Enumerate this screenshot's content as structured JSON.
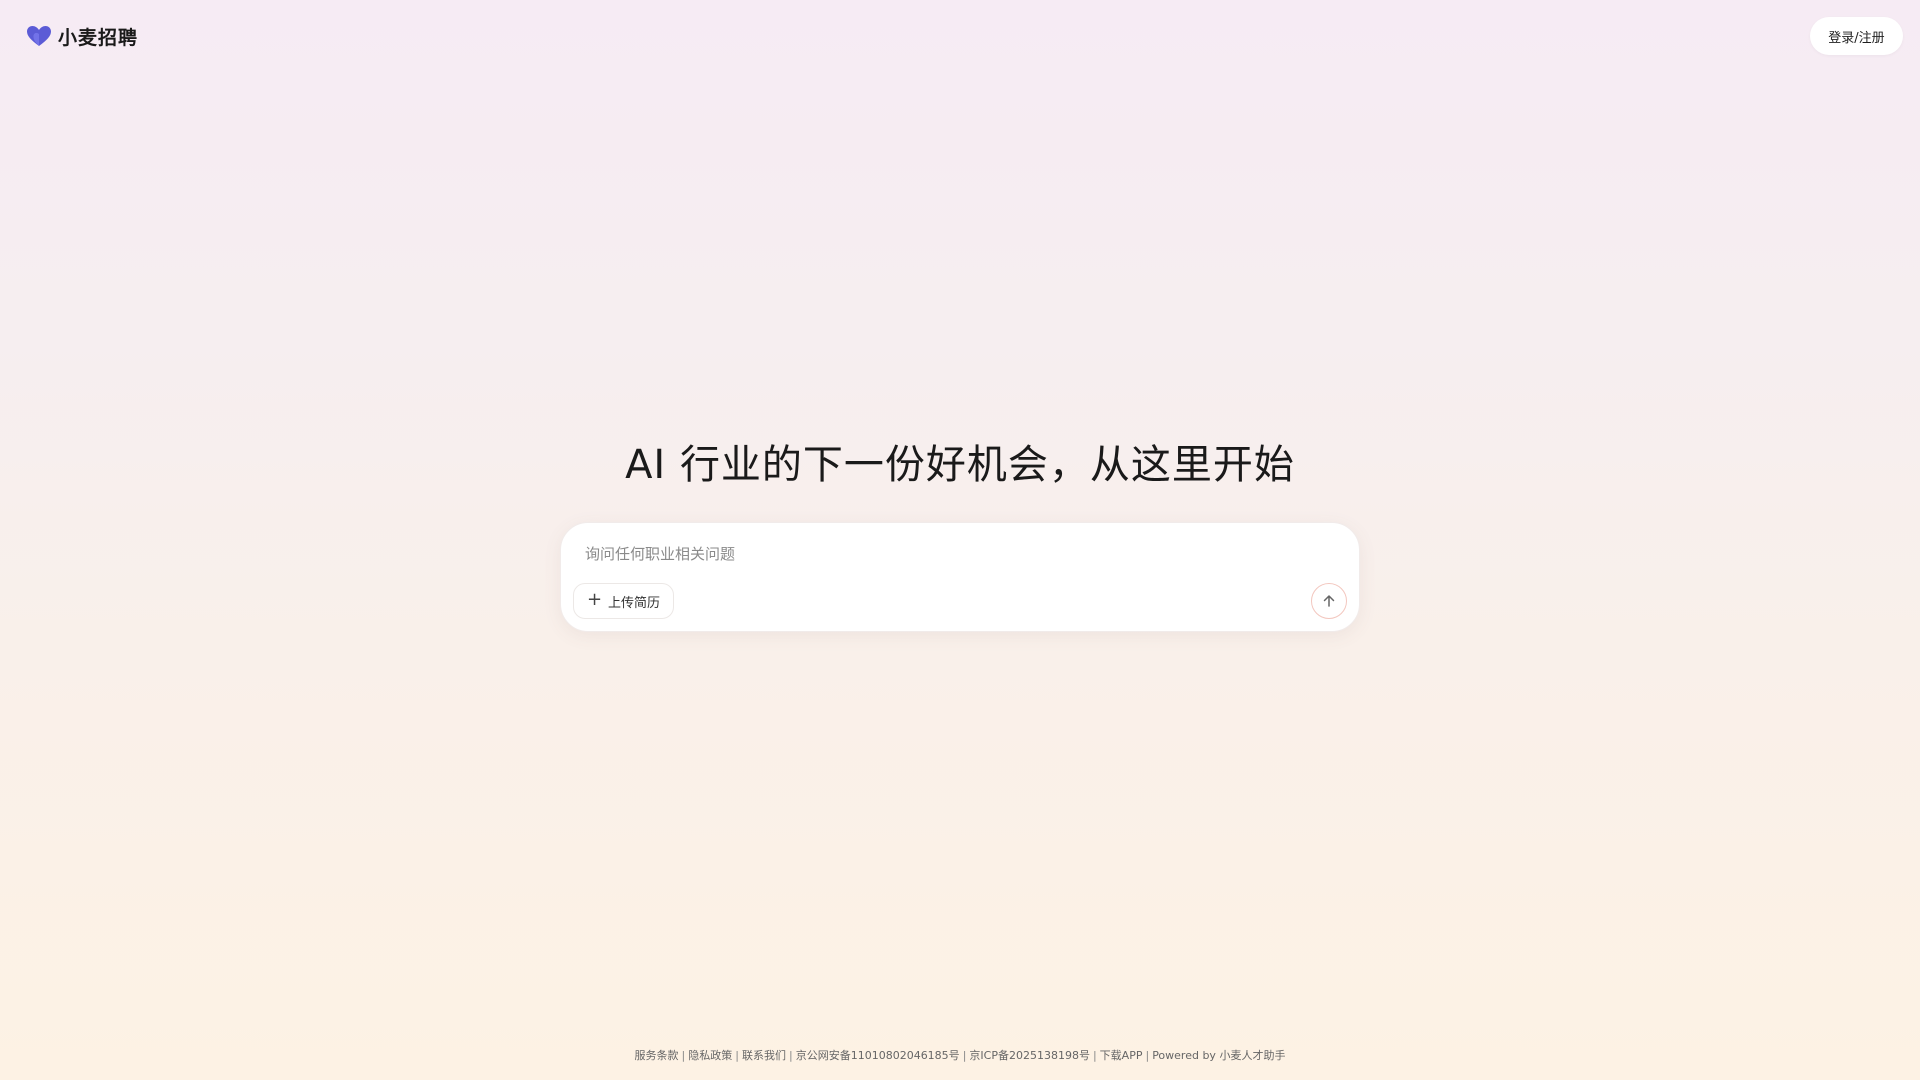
{
  "header": {
    "logo_text": "小麦招聘",
    "login_label": "登录/注册"
  },
  "hero": {
    "title": "AI 行业的下一份好机会，从这里开始"
  },
  "chat": {
    "placeholder": "询问任何职业相关问题",
    "upload_label": "上传简历"
  },
  "footer": {
    "terms": "服务条款",
    "privacy": "隐私政策",
    "contact": "联系我们",
    "police_record": "京公网安备11010802046185号",
    "icp_record": "京ICP备2025138198号",
    "download": "下载APP",
    "powered_by": "Powered by 小麦人才助手",
    "separator": "|"
  },
  "colors": {
    "logo_heart": "#5b5bd6",
    "send_border": "#f3c7bf"
  },
  "icons": {
    "logo": "heart-logo-icon",
    "upload": "plus-icon",
    "send": "arrow-up-icon"
  }
}
